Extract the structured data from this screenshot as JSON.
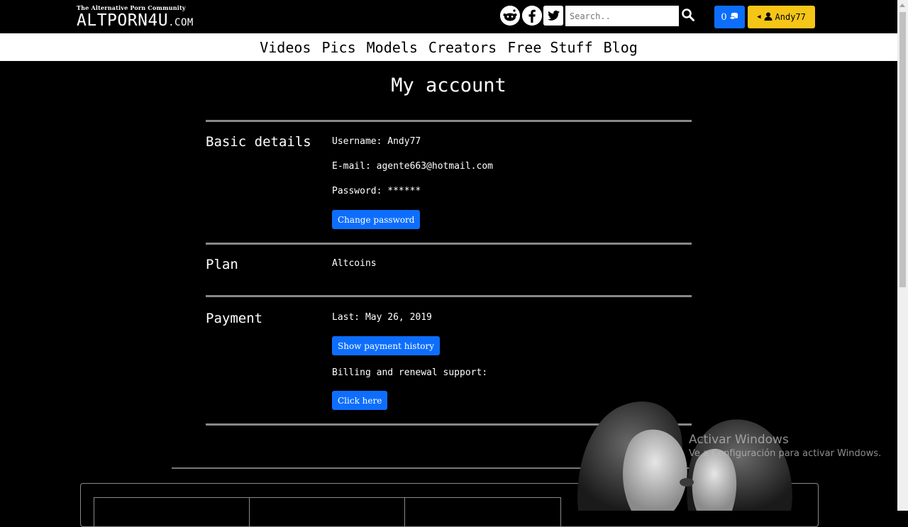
{
  "header": {
    "tagline": "The Alternative Porn Community",
    "brand": "ALTPORN4U",
    "brand_suffix": ".COM",
    "social": [
      {
        "name": "reddit-icon"
      },
      {
        "name": "facebook-icon"
      },
      {
        "name": "twitter-icon"
      }
    ],
    "search_placeholder": "Search..",
    "coins_count": "0",
    "user_name": "Andy77"
  },
  "nav": {
    "items": [
      "Videos",
      "Pics",
      "Models",
      "Creators",
      "Free Stuff",
      "Blog"
    ]
  },
  "account": {
    "title": "My account",
    "basic": {
      "heading": "Basic details",
      "username": "Username: Andy77",
      "email": "E-mail: agente663@hotmail.com",
      "password": "Password: ******",
      "change_password_label": "Change password"
    },
    "plan": {
      "heading": "Plan",
      "value": "Altcoins"
    },
    "payment": {
      "heading": "Payment",
      "last": "Last: May 26, 2019",
      "history_label": "Show payment history",
      "support_text": "Billing and renewal support:",
      "click_here_label": "Click here"
    }
  },
  "watermark": {
    "line1": "Activar Windows",
    "line2": "Ve a Configuración para activar Windows."
  },
  "colors": {
    "accent_blue": "#0d6efd",
    "accent_yellow": "#f5c518",
    "background": "#000000"
  }
}
